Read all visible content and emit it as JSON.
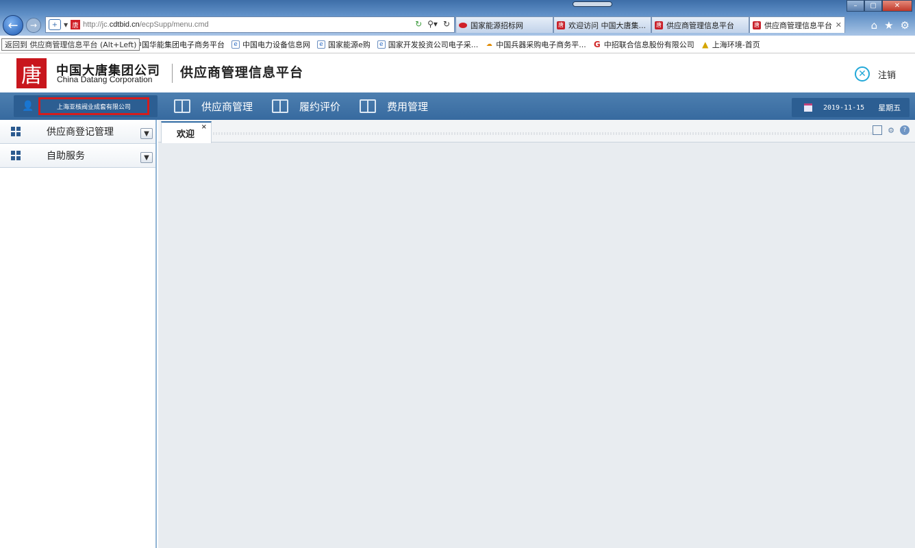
{
  "browser": {
    "address": {
      "url_prefix": "http://jc.",
      "url_domain": "cdtbid.cn",
      "url_path": "/ecpSupp/menu.cmd"
    },
    "tabs": [
      {
        "label": "国家能源招标网",
        "icon": "lips-icon",
        "active": false
      },
      {
        "label": "欢迎访问 中国大唐集...",
        "icon": "datang-favicon",
        "active": false
      },
      {
        "label": "供应商管理信息平台",
        "icon": "datang-favicon",
        "active": false
      },
      {
        "label": "供应商管理信息平台",
        "icon": "datang-favicon",
        "active": true
      }
    ],
    "tooltip": "返回到 供应商管理信息平台 (Alt+Left)",
    "favorites": [
      {
        "label": "中国华能集团电子商务平台",
        "icon": ""
      },
      {
        "label": "中国电力设备信息网",
        "icon": "ie-page-icon"
      },
      {
        "label": "国家能源e购",
        "icon": "ie-page-icon"
      },
      {
        "label": "国家开发投资公司电子采...",
        "icon": "ie-page-icon"
      },
      {
        "label": "中国兵器采购电子商务平...",
        "icon": "cloud-icon"
      },
      {
        "label": "中招联合信息股份有限公司",
        "icon": "g-icon"
      },
      {
        "label": "上海环境-首页",
        "icon": "warning-icon"
      }
    ]
  },
  "header": {
    "logo_glyph": "唐",
    "company_cn": "中国大唐集团公司",
    "company_en": "China Datang Corporation",
    "platform_title": "供应商管理信息平台",
    "logout_label": "注销"
  },
  "topnav": {
    "company_name": "上海亚核阀业成套有限公司",
    "items": [
      {
        "label": "供应商管理"
      },
      {
        "label": "履约评价"
      },
      {
        "label": "费用管理"
      }
    ],
    "date": "2019-11-15",
    "weekday": "星期五"
  },
  "sidebar": {
    "sections": [
      {
        "label": "供应商登记管理"
      },
      {
        "label": "自助服务"
      }
    ]
  },
  "content": {
    "tabs": [
      {
        "label": "欢迎",
        "close": "×"
      }
    ]
  },
  "colors": {
    "brand_red": "#c8161d",
    "nav_blue": "#376a9f",
    "highlight_red": "#d51c1c",
    "logout_cyan": "#22a8d8"
  }
}
